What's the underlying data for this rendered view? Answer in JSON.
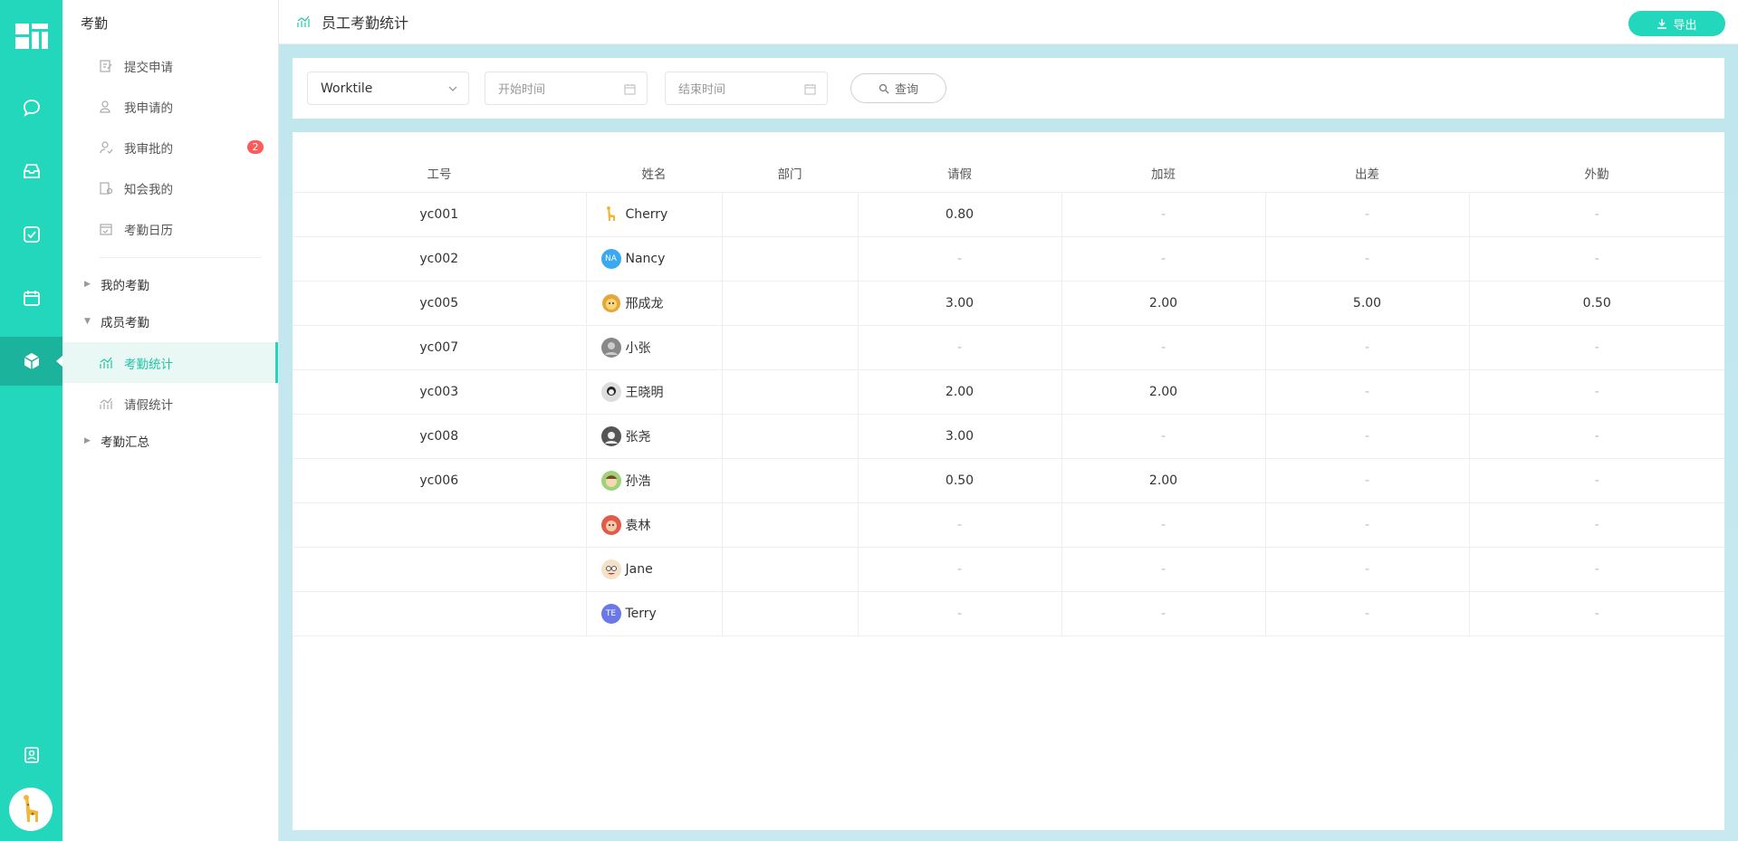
{
  "sidebar": {
    "title": "考勤",
    "items": [
      {
        "label": "提交申请"
      },
      {
        "label": "我申请的"
      },
      {
        "label": "我审批的",
        "badge": "2"
      },
      {
        "label": "知会我的"
      },
      {
        "label": "考勤日历"
      }
    ],
    "groups": {
      "my": "我的考勤",
      "members": "成员考勤",
      "summary": "考勤汇总"
    },
    "member_items": [
      {
        "label": "考勤统计"
      },
      {
        "label": "请假统计"
      }
    ]
  },
  "header": {
    "title": "员工考勤统计",
    "export_label": "导出"
  },
  "filters": {
    "org_select_value": "Worktile",
    "start_placeholder": "开始时间",
    "end_placeholder": "结束时间",
    "search_label": "查询"
  },
  "table": {
    "columns": [
      "工号",
      "姓名",
      "部门",
      "请假",
      "加班",
      "出差",
      "外勤"
    ],
    "rows": [
      {
        "id": "yc001",
        "name": "Cherry",
        "avatar": "giraffe",
        "dept": "",
        "leave": "0.80",
        "overtime": "-",
        "trip": "-",
        "field": "-"
      },
      {
        "id": "yc002",
        "name": "Nancy",
        "avatar": "initials",
        "initials": "NA",
        "avatar_color": "#3aa9f2",
        "dept": "",
        "leave": "-",
        "overtime": "-",
        "trip": "-",
        "field": "-"
      },
      {
        "id": "yc005",
        "name": "邢成龙",
        "avatar": "lion",
        "dept": "",
        "leave": "3.00",
        "overtime": "2.00",
        "trip": "5.00",
        "field": "0.50"
      },
      {
        "id": "yc007",
        "name": "小张",
        "avatar": "photo-gray",
        "dept": "",
        "leave": "-",
        "overtime": "-",
        "trip": "-",
        "field": "-"
      },
      {
        "id": "yc003",
        "name": "王晓明",
        "avatar": "photo-bw",
        "dept": "",
        "leave": "2.00",
        "overtime": "2.00",
        "trip": "-",
        "field": "-"
      },
      {
        "id": "yc008",
        "name": "张尧",
        "avatar": "photo-dark",
        "dept": "",
        "leave": "3.00",
        "overtime": "-",
        "trip": "-",
        "field": "-"
      },
      {
        "id": "yc006",
        "name": "孙浩",
        "avatar": "cartoon-boy",
        "dept": "",
        "leave": "0.50",
        "overtime": "2.00",
        "trip": "-",
        "field": "-"
      },
      {
        "id": "",
        "name": "袁林",
        "avatar": "cartoon-red",
        "dept": "",
        "leave": "-",
        "overtime": "-",
        "trip": "-",
        "field": "-"
      },
      {
        "id": "",
        "name": "Jane",
        "avatar": "cartoon-face",
        "dept": "",
        "leave": "-",
        "overtime": "-",
        "trip": "-",
        "field": "-"
      },
      {
        "id": "",
        "name": "Terry",
        "avatar": "initials",
        "initials": "TE",
        "avatar_color": "#6b78e8",
        "dept": "",
        "leave": "-",
        "overtime": "-",
        "trip": "-",
        "field": "-"
      }
    ]
  },
  "colors": {
    "accent": "#22d7bb",
    "rail": "#22d7bb",
    "badge": "#ff5b5b"
  }
}
